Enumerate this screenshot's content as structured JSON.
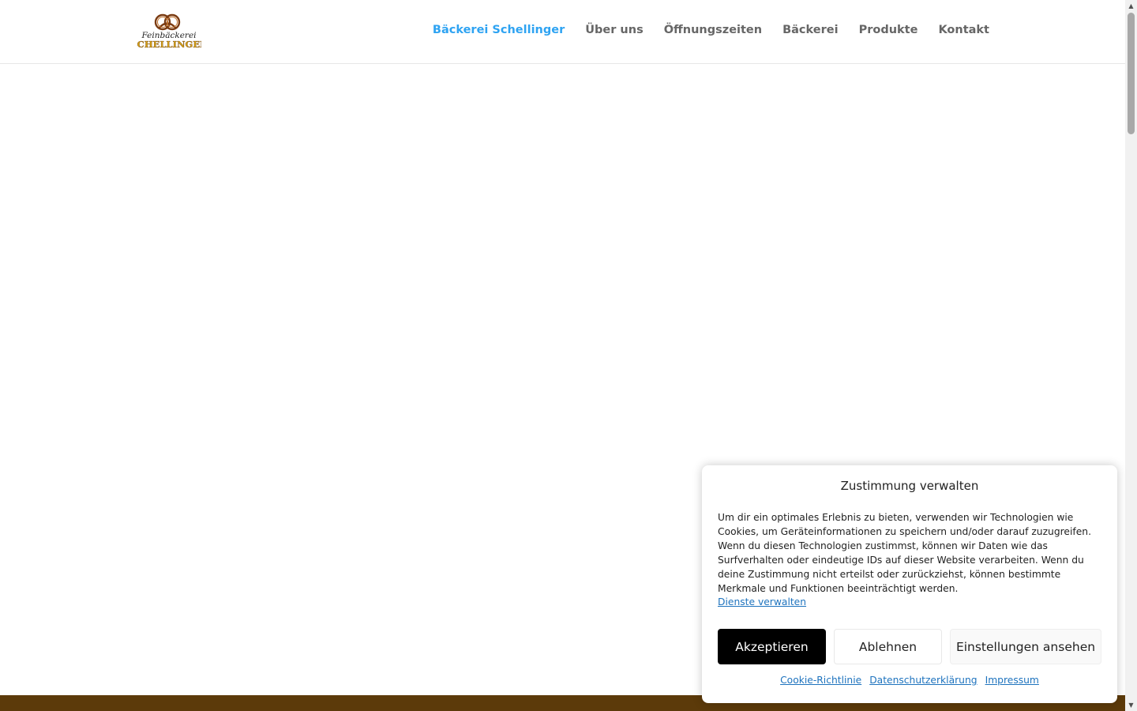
{
  "header": {
    "logo_text": [
      "Feinbäckerei",
      "SCHELLINGER"
    ],
    "nav": [
      {
        "label": "Bäckerei Schellinger",
        "active": true
      },
      {
        "label": "Über uns",
        "active": false
      },
      {
        "label": "Öffnungszeiten",
        "active": false
      },
      {
        "label": "Bäckerei",
        "active": false
      },
      {
        "label": "Produkte",
        "active": false
      },
      {
        "label": "Kontakt",
        "active": false
      }
    ]
  },
  "cookie_banner": {
    "title": "Zustimmung verwalten",
    "text": "Um dir ein optimales Erlebnis zu bieten, verwenden wir Technologien wie Cookies, um Geräteinformationen zu speichern und/oder darauf zuzugreifen. Wenn du diesen Technologien zustimmst, können wir Daten wie das Surfverhalten oder eindeutige IDs auf dieser Website verarbeiten. Wenn du deine Zustimmung nicht erteilst oder zurückziehst, können bestimmte Merkmale und Funktionen beeinträchtigt werden.",
    "manage_link": "Dienste verwalten",
    "accept_label": "Akzeptieren",
    "deny_label": "Ablehnen",
    "prefs_label": "Einstellungen ansehen",
    "links": {
      "cookie_policy": "Cookie-Richtlinie",
      "privacy": "Datenschutzerklärung",
      "imprint": "Impressum"
    }
  },
  "colors": {
    "nav_active": "#2ea3f2",
    "nav_text": "#666666",
    "footer_band": "#5c3a0a",
    "accept_bg": "#000000",
    "link": "#1e73be"
  },
  "icons": {
    "logo": "pretzel-logo-icon",
    "scroll_up": "triangle-up-icon",
    "scroll_down": "triangle-down-icon"
  }
}
